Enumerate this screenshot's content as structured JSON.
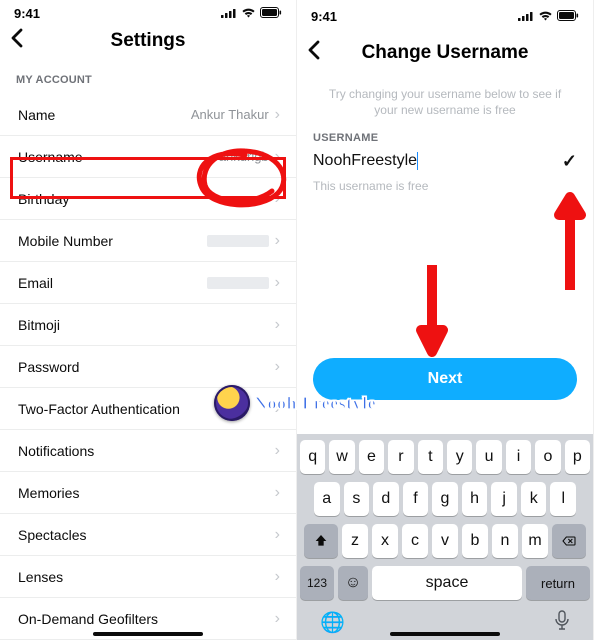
{
  "status": {
    "time": "9:41"
  },
  "left": {
    "title": "Settings",
    "section": "MY ACCOUNT",
    "rows": [
      {
        "label": "Name",
        "value": "Ankur Thakur"
      },
      {
        "label": "Username",
        "value": "ankurigb"
      },
      {
        "label": "Birthday",
        "value": ""
      },
      {
        "label": "Mobile Number",
        "value": ""
      },
      {
        "label": "Email",
        "value": ""
      },
      {
        "label": "Bitmoji",
        "value": ""
      },
      {
        "label": "Password",
        "value": ""
      },
      {
        "label": "Two-Factor Authentication",
        "value": ""
      },
      {
        "label": "Notifications",
        "value": ""
      },
      {
        "label": "Memories",
        "value": ""
      },
      {
        "label": "Spectacles",
        "value": ""
      },
      {
        "label": "Lenses",
        "value": ""
      },
      {
        "label": "On-Demand Geofilters",
        "value": ""
      }
    ]
  },
  "right": {
    "title": "Change Username",
    "helper": "Try changing your username below to see if your new username is free",
    "field_label": "USERNAME",
    "input_value": "NoohFreestyle",
    "hint": "This username is free",
    "button": "Next"
  },
  "keyboard": {
    "r1": [
      "q",
      "w",
      "e",
      "r",
      "t",
      "y",
      "u",
      "i",
      "o",
      "p"
    ],
    "r2": [
      "a",
      "s",
      "d",
      "f",
      "g",
      "h",
      "j",
      "k",
      "l"
    ],
    "r3": [
      "z",
      "x",
      "c",
      "v",
      "b",
      "n",
      "m"
    ],
    "k123": "123",
    "space": "space",
    "return": "return"
  },
  "watermark": "Nooh Freestyle"
}
